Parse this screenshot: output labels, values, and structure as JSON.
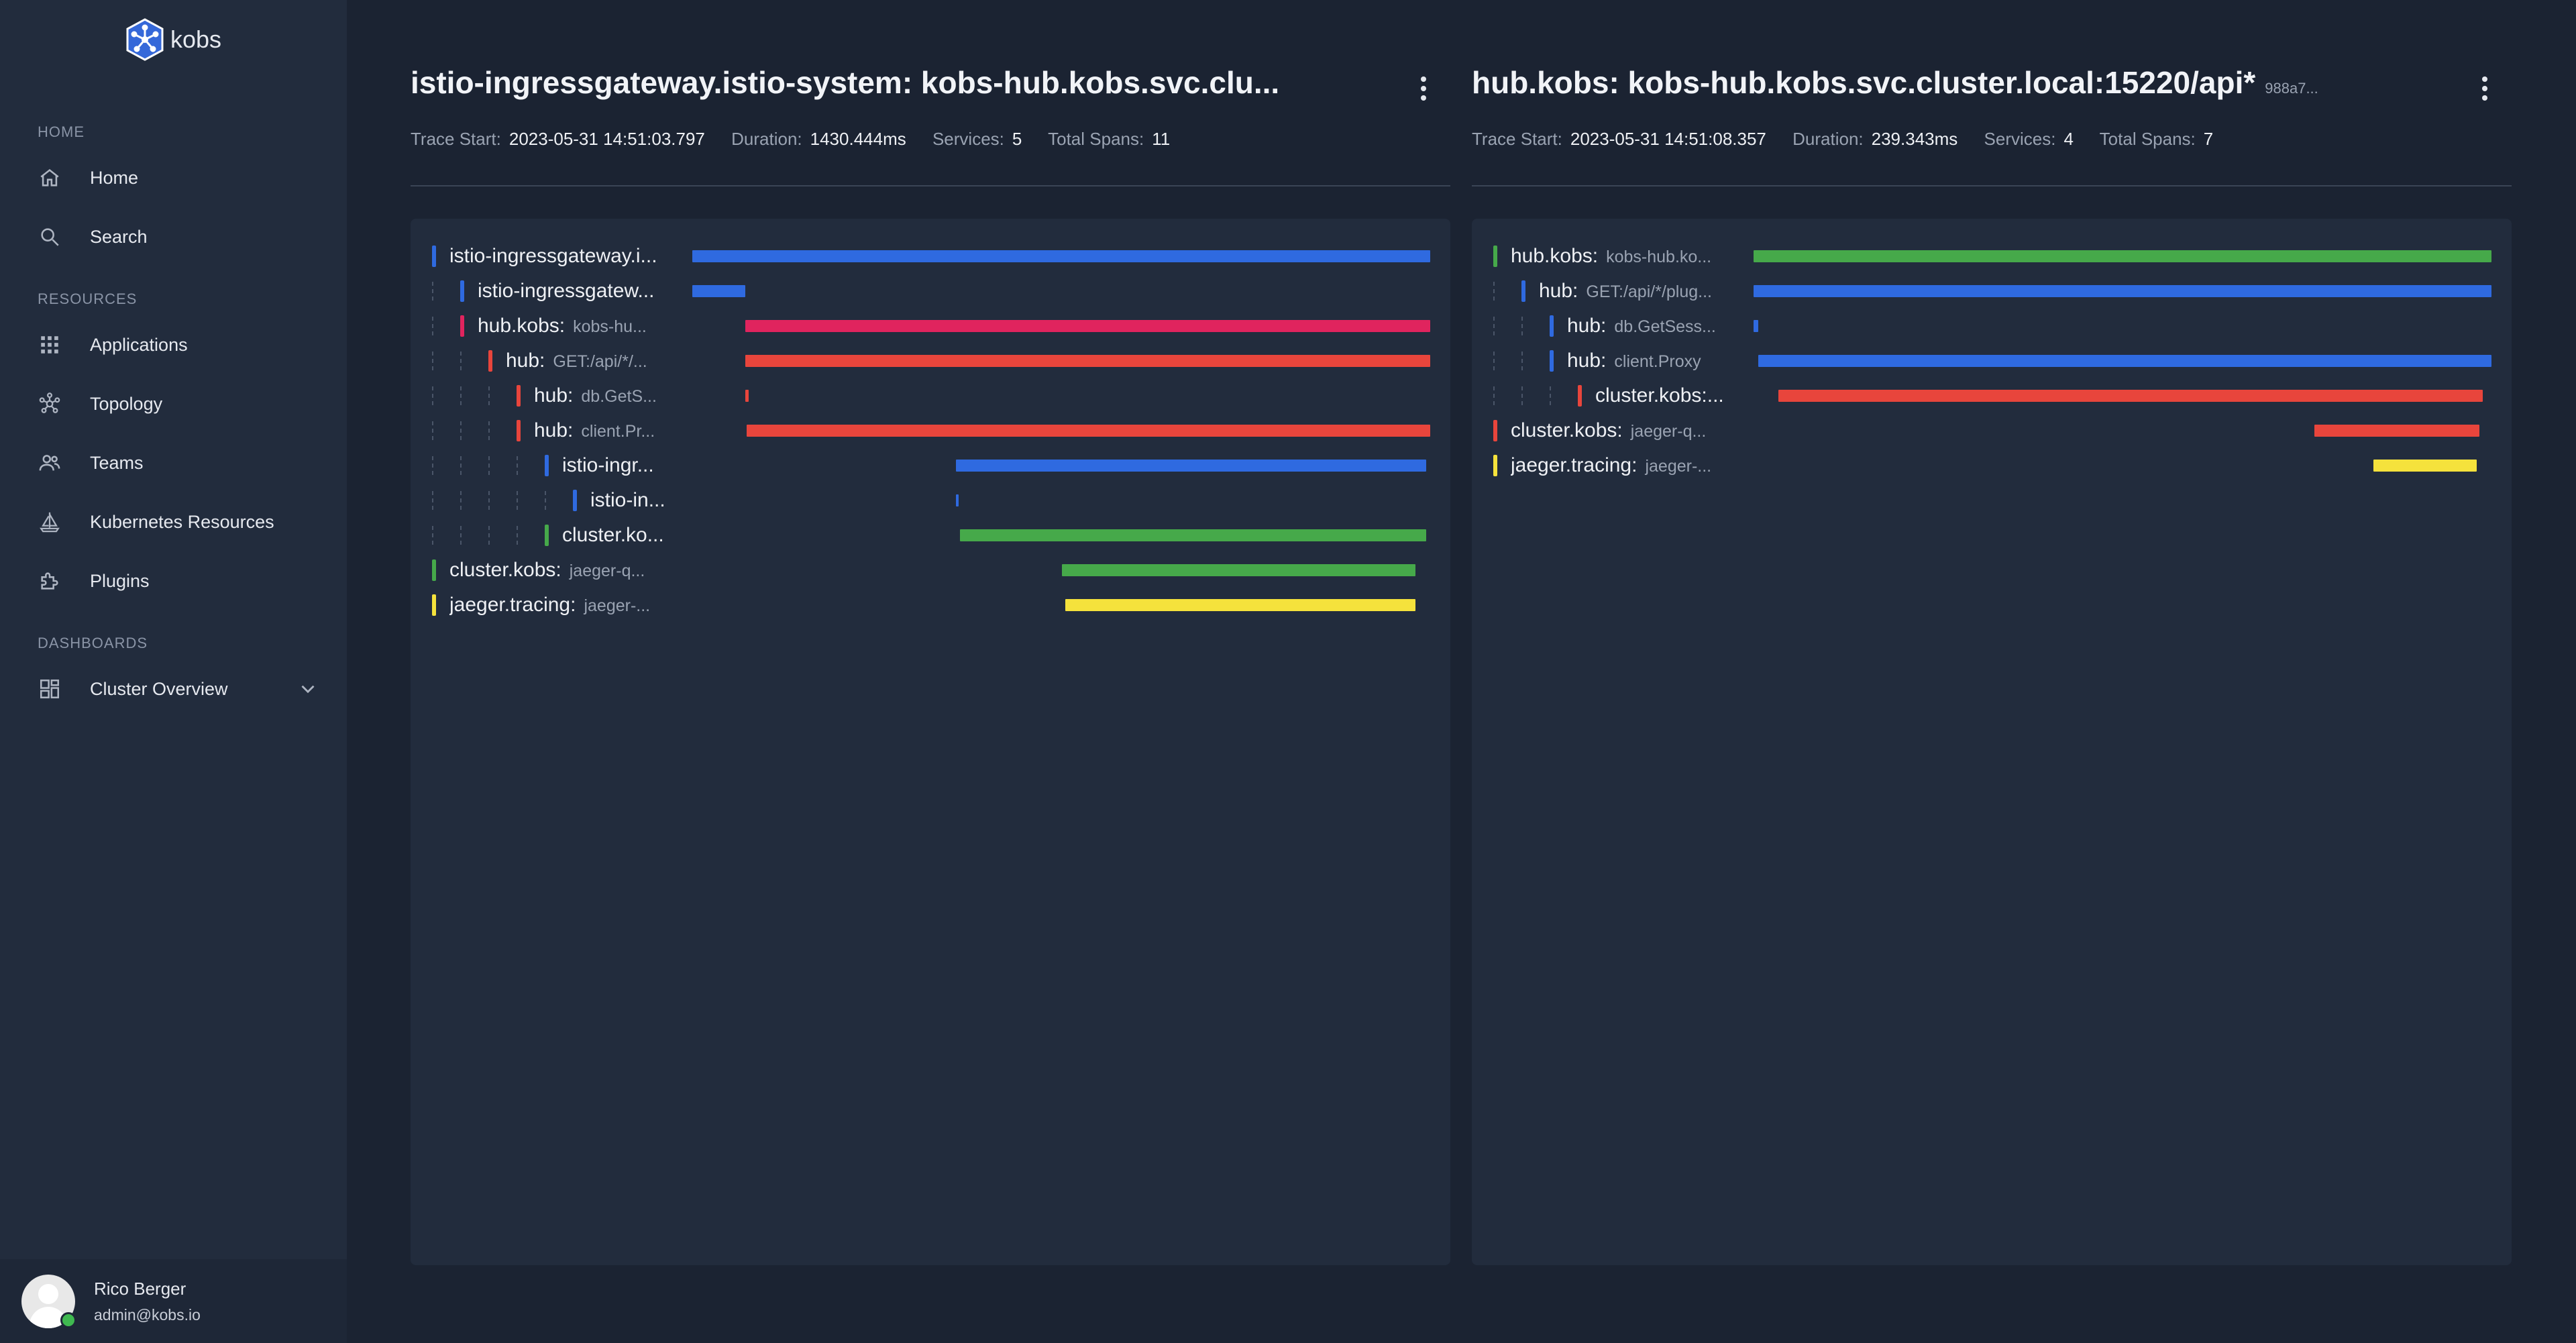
{
  "app": {
    "name": "kobs"
  },
  "sidebar": {
    "sections": [
      {
        "title": "Home",
        "items": [
          {
            "label": "Home",
            "icon": "home-icon"
          },
          {
            "label": "Search",
            "icon": "search-icon"
          }
        ]
      },
      {
        "title": "Resources",
        "items": [
          {
            "label": "Applications",
            "icon": "grid-icon"
          },
          {
            "label": "Topology",
            "icon": "topology-icon"
          },
          {
            "label": "Teams",
            "icon": "team-icon"
          },
          {
            "label": "Kubernetes Resources",
            "icon": "kubernetes-icon"
          },
          {
            "label": "Plugins",
            "icon": "plugin-icon"
          }
        ]
      },
      {
        "title": "Dashboards",
        "items": [
          {
            "label": "Cluster Overview",
            "icon": "dashboard-icon"
          }
        ]
      }
    ]
  },
  "user": {
    "name": "Rico Berger",
    "email": "admin@kobs.io",
    "status_color": "#3fb950"
  },
  "colors": {
    "blue": "#2f6ae0",
    "crimson": "#e0245e",
    "red": "#e8453c",
    "green": "#46a94a",
    "yellow": "#f5e23c"
  },
  "traces": [
    {
      "title": "istio-ingressgateway.istio-system: kobs-hub.kobs.svc.clu...",
      "trace_id": "",
      "meta": {
        "trace_start_label": "Trace Start:",
        "trace_start": "2023-05-31 14:51:03.797",
        "duration_label": "Duration:",
        "duration": "1430.444ms",
        "services_label": "Services:",
        "services": "5",
        "spans_label": "Total Spans:",
        "spans": "11"
      },
      "spans": [
        {
          "service": "istio-ingressgateway.i...",
          "operation": "",
          "depth": 0,
          "color": "blue",
          "start": 0.0,
          "end": 1.0
        },
        {
          "service": "istio-ingressgatew...",
          "operation": "",
          "depth": 1,
          "color": "blue",
          "start": 0.0,
          "end": 0.072
        },
        {
          "service": "hub.kobs:",
          "operation": "kobs-hu...",
          "depth": 1,
          "color": "crimson",
          "start": 0.072,
          "end": 1.0
        },
        {
          "service": "hub:",
          "operation": "GET:/api/*/...",
          "depth": 2,
          "color": "red",
          "start": 0.072,
          "end": 1.0
        },
        {
          "service": "hub:",
          "operation": "db.GetS...",
          "depth": 3,
          "color": "red",
          "start": 0.072,
          "end": 0.076
        },
        {
          "service": "hub:",
          "operation": "client.Pr...",
          "depth": 3,
          "color": "red",
          "start": 0.074,
          "end": 1.0
        },
        {
          "service": "istio-ingr...",
          "operation": "",
          "depth": 4,
          "color": "blue",
          "start": 0.357,
          "end": 0.995
        },
        {
          "service": "istio-in...",
          "operation": "",
          "depth": 5,
          "color": "blue",
          "start": 0.357,
          "end": 0.361
        },
        {
          "service": "cluster.ko...",
          "operation": "",
          "depth": 4,
          "color": "green",
          "start": 0.363,
          "end": 0.995
        },
        {
          "service": "cluster.kobs:",
          "operation": "jaeger-q...",
          "depth": 0,
          "color": "green",
          "start": 0.501,
          "end": 0.98
        },
        {
          "service": "jaeger.tracing:",
          "operation": "jaeger-...",
          "depth": 0,
          "color": "yellow",
          "start": 0.505,
          "end": 0.98
        }
      ]
    },
    {
      "title": "hub.kobs: kobs-hub.kobs.svc.cluster.local:15220/api*",
      "trace_id": "988a7...",
      "meta": {
        "trace_start_label": "Trace Start:",
        "trace_start": "2023-05-31 14:51:08.357",
        "duration_label": "Duration:",
        "duration": "239.343ms",
        "services_label": "Services:",
        "services": "4",
        "spans_label": "Total Spans:",
        "spans": "7"
      },
      "spans": [
        {
          "service": "hub.kobs:",
          "operation": "kobs-hub.ko...",
          "depth": 0,
          "color": "green",
          "start": 0.0,
          "end": 1.0
        },
        {
          "service": "hub:",
          "operation": "GET:/api/*/plug...",
          "depth": 1,
          "color": "blue",
          "start": 0.0,
          "end": 1.0
        },
        {
          "service": "hub:",
          "operation": "db.GetSess...",
          "depth": 2,
          "color": "blue",
          "start": 0.0,
          "end": 0.006
        },
        {
          "service": "hub:",
          "operation": "client.Proxy",
          "depth": 2,
          "color": "blue",
          "start": 0.006,
          "end": 1.0
        },
        {
          "service": "cluster.kobs:...",
          "operation": "",
          "depth": 3,
          "color": "red",
          "start": 0.034,
          "end": 0.988
        },
        {
          "service": "cluster.kobs:",
          "operation": "jaeger-q...",
          "depth": 0,
          "color": "red",
          "start": 0.76,
          "end": 0.984
        },
        {
          "service": "jaeger.tracing:",
          "operation": "jaeger-...",
          "depth": 0,
          "color": "yellow",
          "start": 0.84,
          "end": 0.98
        }
      ]
    }
  ]
}
